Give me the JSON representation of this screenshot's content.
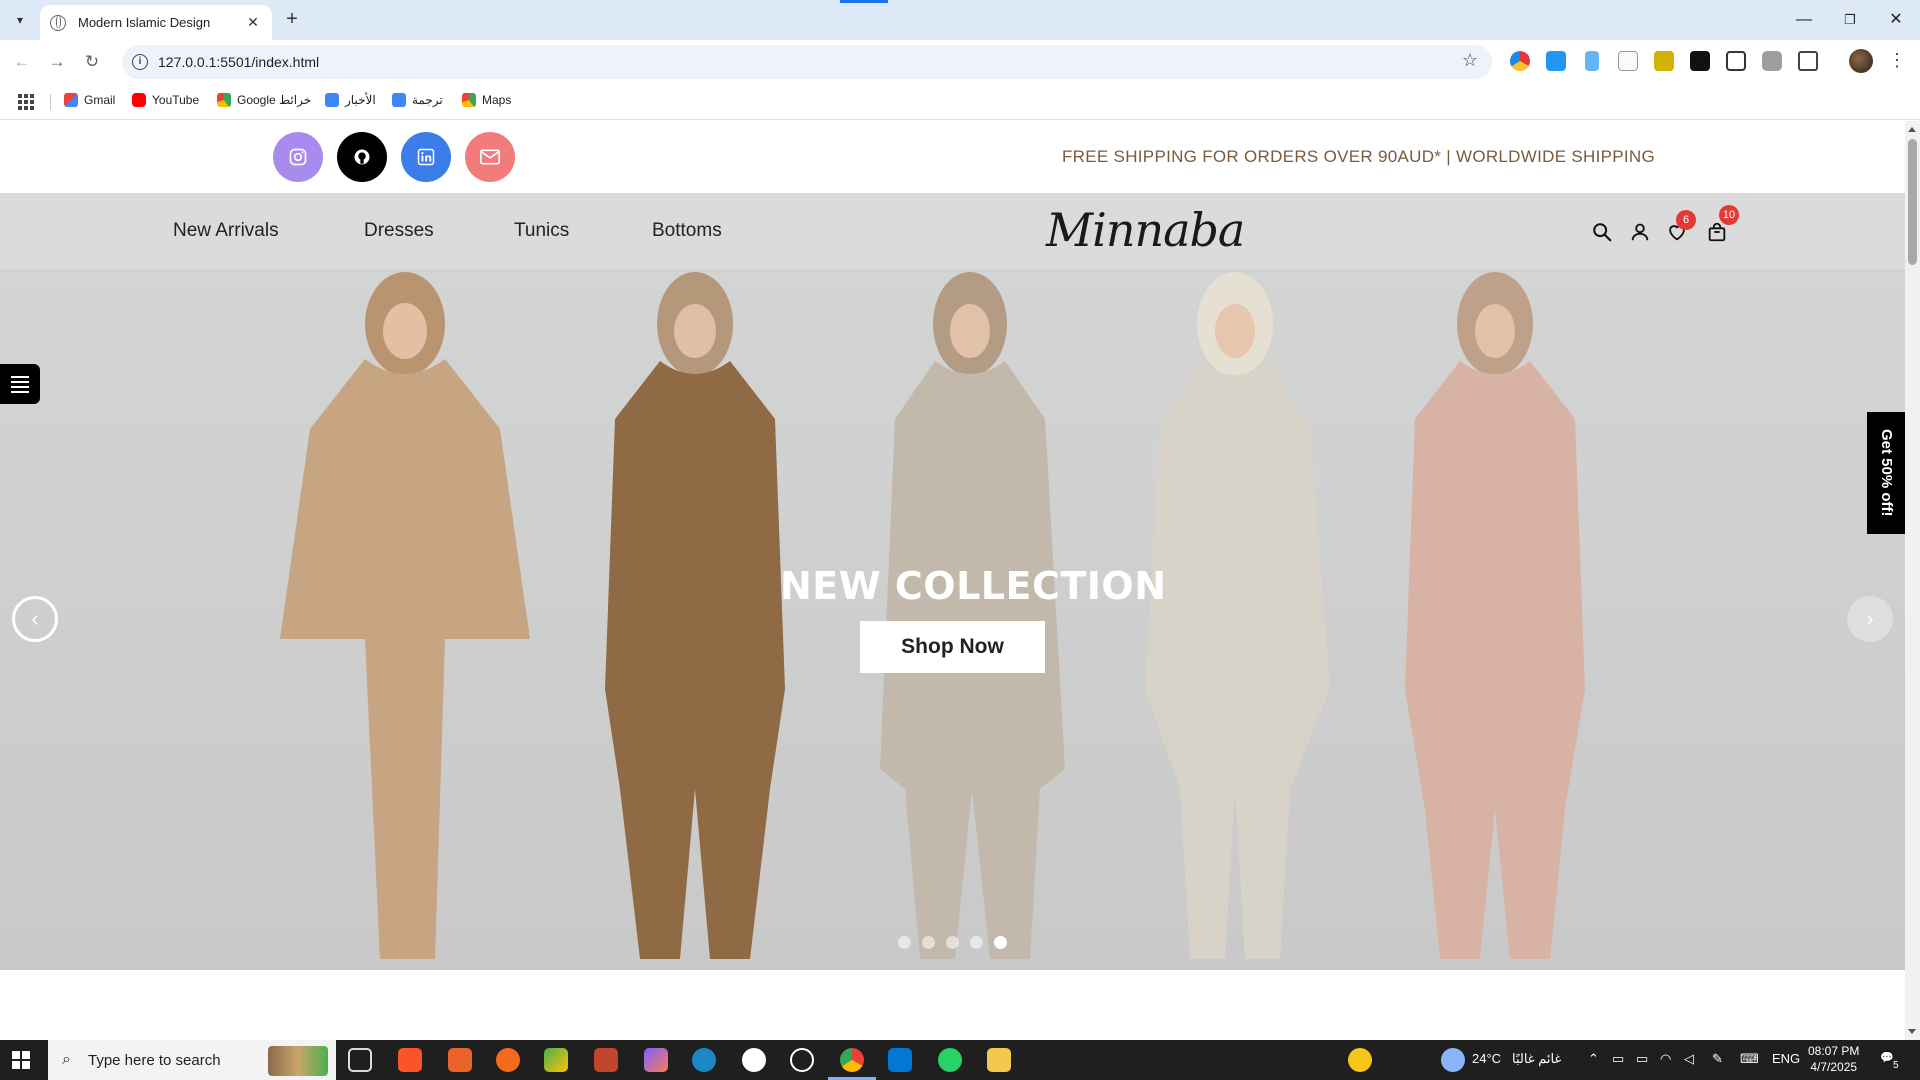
{
  "browser": {
    "tab_title": "Modern Islamic Design",
    "url": "127.0.0.1:5501/index.html",
    "bookmarks": [
      "Gmail",
      "YouTube",
      "Google خرائط",
      "الأخبار",
      "ترجمة",
      "Maps"
    ]
  },
  "page": {
    "shipping_note": "FREE SHIPPING FOR ORDERS OVER 90AUD* | WORLDWIDE SHIPPING",
    "social": [
      {
        "name": "instagram",
        "color": "#a98bf0"
      },
      {
        "name": "github",
        "color": "#000000"
      },
      {
        "name": "linkedin",
        "color": "#3b7de9"
      },
      {
        "name": "email",
        "color": "#f27c7c"
      }
    ],
    "nav_links": [
      "New Arrivals",
      "Dresses",
      "Tunics",
      "Bottoms"
    ],
    "logo": "Minnaba",
    "wishlist_count": "6",
    "cart_count": "10",
    "hero": {
      "title": "NEW COLLECTION",
      "button": "Shop Now",
      "slide_count": 5,
      "active_slide": 5
    },
    "promo_tab": "Get 50% off!",
    "colors": {
      "accent_brown": "#7b5a3c",
      "badge_red": "#e53935",
      "navbar_bg": "#dbdbdb"
    }
  },
  "taskbar": {
    "search_placeholder": "Type here to search",
    "weather_temp": "24°C",
    "weather_text": "غائم غالبًا",
    "language": "ENG",
    "time": "08:07 PM",
    "date": "4/7/2025",
    "notification_count": "5"
  }
}
